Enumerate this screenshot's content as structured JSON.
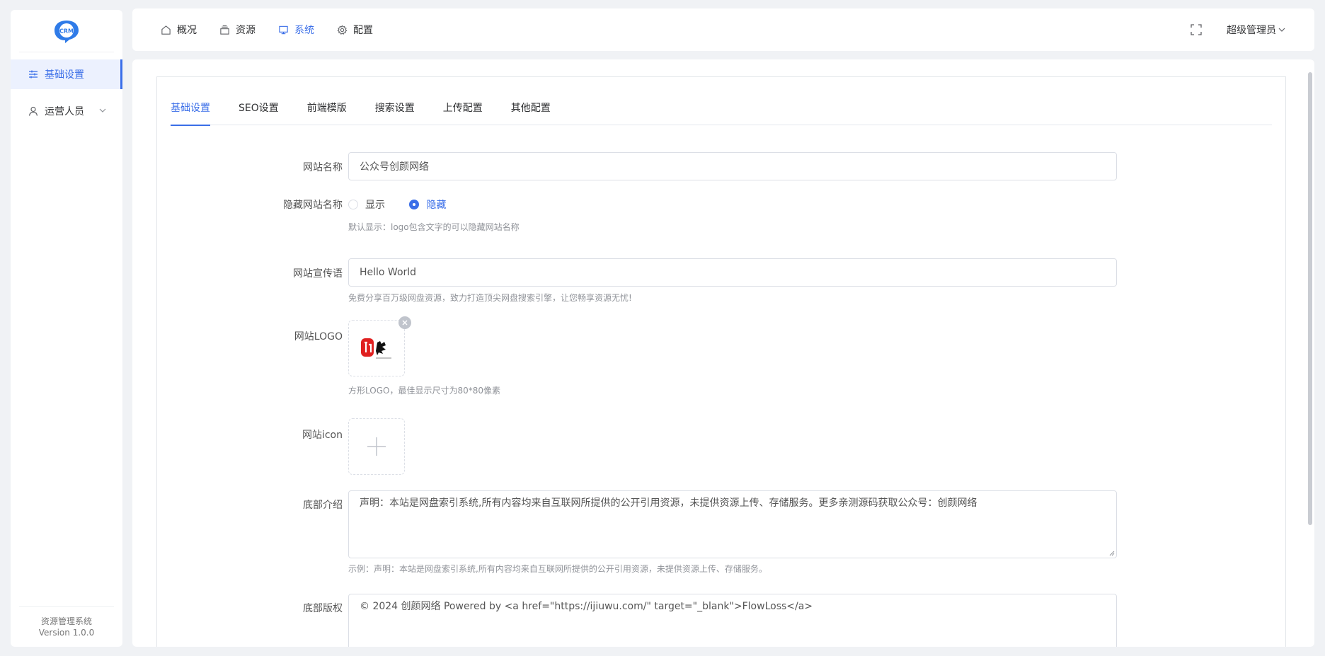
{
  "sidebar": {
    "logo_text": "CRM",
    "items": [
      {
        "label": "基础设置",
        "icon": "sliders-icon",
        "active": true
      },
      {
        "label": "运营人员",
        "icon": "user-icon",
        "active": false
      }
    ],
    "footer_title": "资源管理系统",
    "footer_version": "Version 1.0.0"
  },
  "topnav": {
    "items": [
      {
        "label": "概况",
        "icon": "home-icon",
        "active": false
      },
      {
        "label": "资源",
        "icon": "layers-icon",
        "active": false
      },
      {
        "label": "系统",
        "icon": "monitor-icon",
        "active": true
      },
      {
        "label": "配置",
        "icon": "gear-icon",
        "active": false
      }
    ],
    "user": "超级管理员"
  },
  "tabs": [
    "基础设置",
    "SEO设置",
    "前端模版",
    "搜索设置",
    "上传配置",
    "其他配置"
  ],
  "form": {
    "site_name": {
      "label": "网站名称",
      "value": "公众号创颜网络"
    },
    "hide_name": {
      "label": "隐藏网站名称",
      "options": [
        "显示",
        "隐藏"
      ],
      "selected": "隐藏",
      "hint": "默认显示：logo包含文字的可以隐藏网站名称"
    },
    "slogan": {
      "label": "网站宣传语",
      "value": "Hello World",
      "hint": "免费分享百万级网盘资源，致力打造顶尖网盘搜索引擎，让您畅享资源无忧!"
    },
    "logo": {
      "label": "网站LOGO",
      "hint": "方形LOGO，最佳显示尺寸为80*80像素"
    },
    "icon": {
      "label": "网站icon"
    },
    "footer_intro": {
      "label": "底部介绍",
      "value": "声明：本站是网盘索引系统,所有内容均来自互联网所提供的公开引用资源，未提供资源上传、存储服务。更多亲测源码获取公众号：创颜网络",
      "hint": "示例：声明：本站是网盘索引系统,所有内容均来自互联网所提供的公开引用资源，未提供资源上传、存储服务。"
    },
    "copyright": {
      "label": "底部版权",
      "value": "© 2024 创颜网络 Powered by <a href=\"https://ijiuwu.com/\" target=\"_blank\">FlowLoss</a>"
    }
  },
  "colors": {
    "accent": "#3a6ee8"
  }
}
